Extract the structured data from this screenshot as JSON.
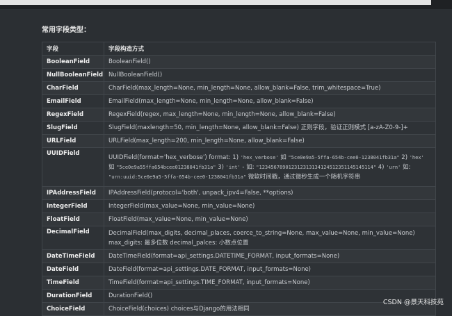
{
  "heading": "常用字段类型：",
  "table": {
    "headers": [
      "字段",
      "字段构造方式"
    ],
    "rows": [
      {
        "name": "BooleanField",
        "desc": "BooleanField()"
      },
      {
        "name": "NullBooleanField",
        "desc": "NullBooleanField()"
      },
      {
        "name": "CharField",
        "desc": "CharField(max_length=None, min_length=None, allow_blank=False, trim_whitespace=True)"
      },
      {
        "name": "EmailField",
        "desc": "EmailField(max_length=None, min_length=None, allow_blank=False)"
      },
      {
        "name": "RegexField",
        "desc": "RegexField(regex, max_length=None, min_length=None, allow_blank=False)"
      },
      {
        "name": "SlugField",
        "desc": "SlugField(maxlength=50, min_length=None, allow_blank=False) 正则字段，验证正则模式 [a-zA-Z0-9-]+"
      },
      {
        "name": "URLField",
        "desc": "URLField(max_length=200, min_length=None, allow_blank=False)"
      },
      {
        "name": "UUIDField",
        "desc_parts": [
          {
            "t": "UUIDField(format='hex_verbose') format: 1) "
          },
          {
            "c": "'hex_verbose'"
          },
          {
            "t": " 如 "
          },
          {
            "c": "\"5ce0e9a5-5ffa-654b-cee0-1238041fb31a\""
          },
          {
            "t": " 2) "
          },
          {
            "c": "'hex'"
          },
          {
            "t": " 如 "
          },
          {
            "c": "\"5ce0e9a55ffa654bcee01238041fb31a\""
          },
          {
            "t": " 3) "
          },
          {
            "c": "'int'"
          },
          {
            "t": " - 如: "
          },
          {
            "c": "\"123456789012312313134124512351145145114\""
          },
          {
            "t": " 4) "
          },
          {
            "c": "'urn'"
          },
          {
            "t": " 如: "
          },
          {
            "c": "\"urn:uuid:5ce0e9a5-5ffa-654b-cee0-1238041fb31a\""
          },
          {
            "t": " 微软时间戳，通过微秒生成一个随机字符串"
          }
        ]
      },
      {
        "name": "IPAddressField",
        "desc": "IPAddressField(protocol='both', unpack_ipv4=False, **options)"
      },
      {
        "name": "IntegerField",
        "desc": "IntegerField(max_value=None, min_value=None)"
      },
      {
        "name": "FloatField",
        "desc": "FloatField(max_value=None, min_value=None)"
      },
      {
        "name": "DecimalField",
        "desc": "DecimalField(max_digits, decimal_places, coerce_to_string=None, max_value=None, min_value=None) max_digits: 最多位数 decimal_palces: 小数点位置"
      },
      {
        "name": "DateTimeField",
        "desc": "DateTimeField(format=api_settings.DATETIME_FORMAT, input_formats=None)"
      },
      {
        "name": "DateField",
        "desc": "DateField(format=api_settings.DATE_FORMAT, input_formats=None)"
      },
      {
        "name": "TimeField",
        "desc": "TimeField(format=api_settings.TIME_FORMAT, input_formats=None)"
      },
      {
        "name": "DurationField",
        "desc": "DurationField()"
      },
      {
        "name": "ChoiceField",
        "desc": "ChoiceField(choices) choices与Django的用法相同"
      }
    ]
  },
  "watermark": "CSDN @景天科技苑"
}
